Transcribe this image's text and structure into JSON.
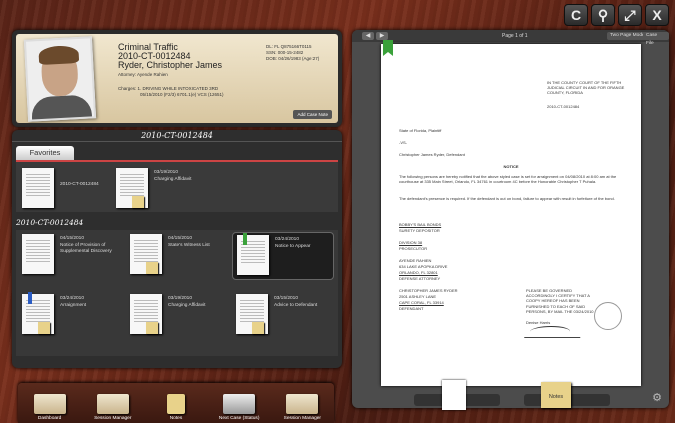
{
  "toolbar": {
    "buttons": [
      {
        "name": "refresh",
        "glyph": "C"
      },
      {
        "name": "search",
        "glyph": "⚲"
      },
      {
        "name": "expand",
        "glyph": "⤢"
      },
      {
        "name": "close",
        "glyph": "X"
      }
    ]
  },
  "case": {
    "type": "Criminal Traffic",
    "number": "2010-CT-0012484",
    "name": "Ryder, Christopher James",
    "attorney": "Attorney: Ayende Rahien",
    "charges": "Charges: 1. DRIVING WHILE INTOXICATED 3RD",
    "charges_detail": "05/15/2010 (F2/3) 6701.1(e) VCS (12651)",
    "dl": "DL: FL Q875166T0115",
    "ssn": "SSN: 000-15-2482",
    "dob": "DOB: 04/26/1983 (Age:27)",
    "add_note": "Add Case Note"
  },
  "docs_panel": {
    "heading": "2010-CT-0012484",
    "favorites_tab": "Favorites",
    "favorites": [
      {
        "label": "2010-CT-0012484"
      },
      {
        "date": "03/19/2010",
        "title": "Charging Affidavit"
      }
    ],
    "section_heading": "2010-CT-0012484",
    "documents": [
      {
        "date": "04/15/2010",
        "title": "Notice of Provision of Supplemental Discovery"
      },
      {
        "date": "04/15/2010",
        "title": "State's Witness List"
      },
      {
        "date": "03/24/2010",
        "title": "Notice to Appear"
      },
      {
        "date": "03/24/2010",
        "title": "Arraignment"
      },
      {
        "date": "03/19/2010",
        "title": "Charging Affidavit"
      },
      {
        "date": "03/15/2010",
        "title": "Advice to Defendant"
      }
    ]
  },
  "dock": {
    "items": [
      {
        "label": "Dashboard"
      },
      {
        "label": "Session Manager"
      },
      {
        "label": "Notes"
      },
      {
        "label": "Next Case (Status)"
      },
      {
        "label": "Session Manager"
      }
    ]
  },
  "viewer": {
    "page_indicator": "Page 1 of 1",
    "two_page_mode": "Two Page Mode",
    "case_file": "Case File",
    "notes_label": "Notes",
    "document": {
      "court": "IN THE COUNTY COURT OF THE FIFTH JUDICIAL CIRCUIT IN AND FOR ORANGE COUNTY, FLORIDA",
      "case_no": "2010-CT-0012484",
      "plaintiff": "State of Florida, Plaintiff",
      "vs": "-VS-",
      "defendant": "Christopher James Ryder, Defendant",
      "notice_title": "NOTICE",
      "p1": "The following persons are hereby notified that the above styled case is set for arraignment on 04/08/2010 at 8:00 am at the courthouse at 335 Main Street, Orlando, FL 34761 in courtroom 4C before the Honorable Christopher T Puhala.",
      "p2": "The defendant's presence is required. If the defendant is out on bond, failure to appear with result in forfeiture of the bond.",
      "surety_name": "BOBBY'S BAIL BONDS",
      "surety_role": "SURETY DEPOSITOR",
      "pros_name": "DIVISION 38",
      "pros_role": "PROSECUTOR",
      "def_att_name": "AYENDE RAHIEN",
      "def_att_addr1": "634 LAKE APOPKA DRIVE",
      "def_att_addr2": "ORLANDO, FL 32801",
      "def_att_role": "DEFENSE ATTORNEY",
      "def_name": "CHRISTOPHER JAMES RYDER",
      "def_addr1": "2501 ASHLEY LANE",
      "def_addr2": "CAPE CORAL, FL 33914",
      "def_role": "DEFENDANT",
      "certify": "PLEASE BE GOVERNED ACCORDINGLY I CERTIFY THAT A COOPY HEREOF HAS BEEN FURNISHED TO EACH OF SAID PERSONS, BY MAIL THE 03/24/2010",
      "signer": "Denise Harris"
    }
  }
}
